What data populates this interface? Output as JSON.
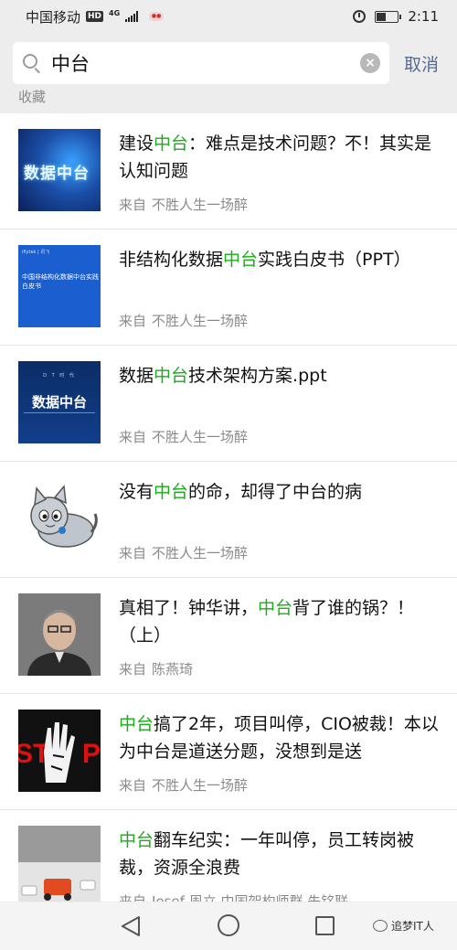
{
  "status_bar": {
    "carrier": "中国移动",
    "hd_badge": "HD",
    "network": "4G",
    "time": "2:11"
  },
  "search": {
    "query": "中台",
    "cancel_label": "取消"
  },
  "section_label": "收藏",
  "results": [
    {
      "title_parts": [
        "建设",
        "中台",
        "：难点是技术问题？不！其实是认知问题"
      ],
      "from_label": "来自",
      "source": "不胜人生一场醉",
      "thumb_text": "数据中台"
    },
    {
      "title_parts": [
        "非结构化数据",
        "中台",
        "实践白皮书（PPT）"
      ],
      "from_label": "来自",
      "source": "不胜人生一场醉",
      "thumb_logo": "iflytek | 讯飞",
      "thumb_text": "中国非结构化数据中台实践白皮书"
    },
    {
      "title_parts": [
        "数据",
        "中台",
        "技术架构方案.ppt"
      ],
      "from_label": "来自",
      "source": "不胜人生一场醉",
      "thumb_small": "D T 时 代",
      "thumb_text": "数据中台"
    },
    {
      "title_parts": [
        "没有",
        "中台",
        "的命，却得了中台的病"
      ],
      "from_label": "来自",
      "source": "不胜人生一场醉"
    },
    {
      "title_parts": [
        "真相了！钟华讲，",
        "中台",
        "背了谁的锅？！（上）"
      ],
      "from_label": "来自",
      "source": "陈燕琦"
    },
    {
      "title_parts": [
        "",
        "中台",
        "搞了2年，项目叫停，CIO被裁！本以为中台是道送分题，没想到是送"
      ],
      "from_label": "来自",
      "source": "不胜人生一场醉",
      "thumb_text": "STOP"
    },
    {
      "title_parts": [
        "",
        "中台",
        "翻车纪实：一年叫停，员工转岗被裁，资源全浪费"
      ],
      "from_label": "来自",
      "source": "Josef 周立  中国架构师群  朱铭联"
    }
  ],
  "watermark": "追梦IT人"
}
